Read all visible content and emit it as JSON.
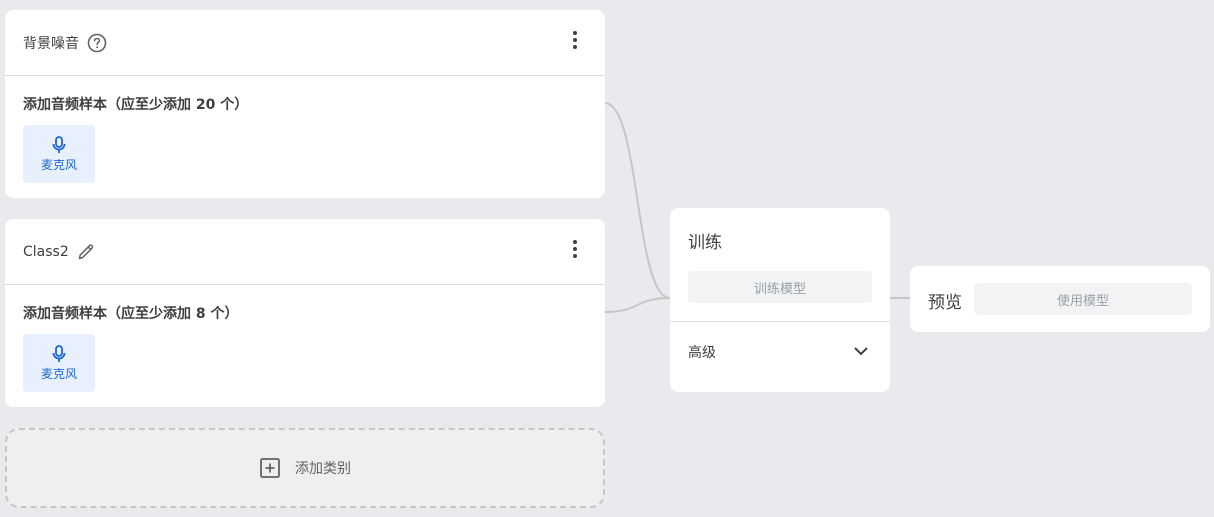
{
  "classes": [
    {
      "name": "背景噪音",
      "sample_prompt": "添加音频样本（应至少添加 20 个）",
      "mic_label": "麦克风"
    },
    {
      "name": "Class2",
      "sample_prompt": "添加音频样本（应至少添加 8 个）",
      "mic_label": "麦克风"
    }
  ],
  "add_class": {
    "label": "添加类别"
  },
  "training": {
    "title": "训练",
    "train_button": "训练模型",
    "advanced_label": "高级"
  },
  "preview": {
    "title": "预览",
    "use_model_button": "使用模型"
  },
  "colors": {
    "accent": "#1967d2",
    "mic_button_bg": "#e8f0fe",
    "canvas_bg": "#e8eaed",
    "disabled_text": "#9aa0a6"
  },
  "icons": [
    "help-icon",
    "more-vert-icon",
    "edit-icon",
    "mic-icon",
    "add-box-icon",
    "chevron-down-icon"
  ]
}
